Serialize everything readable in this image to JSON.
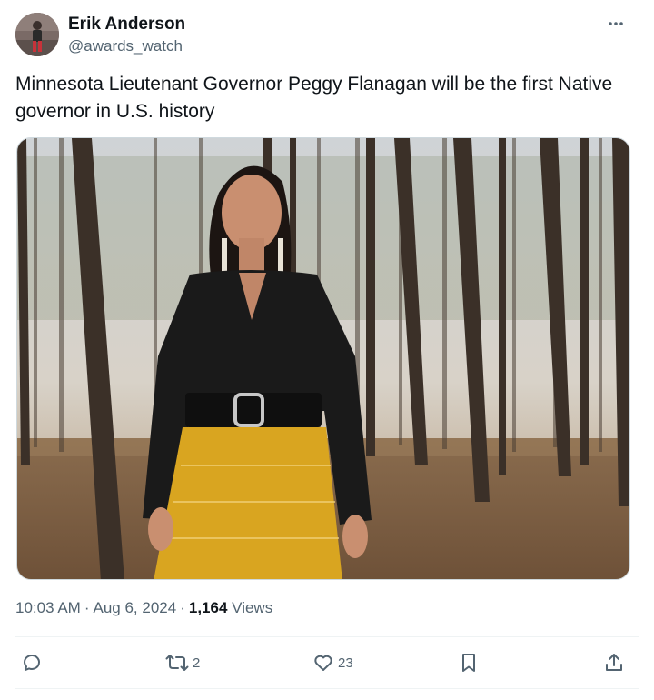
{
  "user": {
    "display_name": "Erik Anderson",
    "handle": "@awards_watch"
  },
  "tweet": {
    "text": "Minnesota Lieutenant Governor Peggy Flanagan will be the first Native governor in U.S. history"
  },
  "meta": {
    "time": "10:03 AM",
    "date": "Aug 6, 2024",
    "view_count": "1,164",
    "views_label": "Views",
    "separator": "·"
  },
  "actions": {
    "reply_count": "",
    "retweet_count": "2",
    "like_count": "23"
  },
  "icons": {
    "more": "more-horizontal-icon",
    "reply": "reply-bubble-icon",
    "retweet": "retweet-icon",
    "like": "heart-icon",
    "bookmark": "bookmark-icon",
    "share": "share-upload-icon"
  },
  "colors": {
    "text_primary": "#0f1419",
    "text_secondary": "#536471",
    "skirt_yellow": "#d9a520",
    "top_black": "#1a1a1a"
  }
}
